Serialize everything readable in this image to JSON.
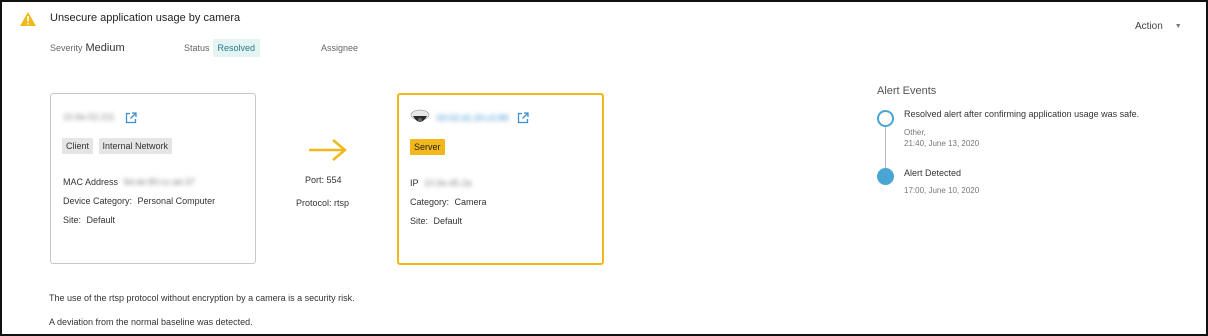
{
  "alert": {
    "title": "Unsecure application usage by camera",
    "action_label": "Action",
    "severity_label": "Severity",
    "severity_value": "Medium",
    "status_label": "Status",
    "status_value": "Resolved",
    "assignee_label": "Assignee"
  },
  "source": {
    "ip": "10.6e.52.211",
    "tags": [
      "Client",
      "Internal Network"
    ],
    "mac_label": "MAC Address",
    "mac_value": "9d:de:80:cc:ab:37",
    "category_label": "Device Category:",
    "category_value": "Personal Computer",
    "site_label": "Site:",
    "site_value": "Default"
  },
  "connection": {
    "port": "Port: 554",
    "protocol": "Protocol: rtsp"
  },
  "destination": {
    "mac": "00:02:d1:20:c0:89",
    "tag": "Server",
    "ip_label": "IP",
    "ip_value": "10.6e.d5.2a",
    "category_label": "Category:",
    "category_value": "Camera",
    "site_label": "Site:",
    "site_value": "Default"
  },
  "events": {
    "title": "Alert Events",
    "items": [
      {
        "text": "Resolved alert after confirming application usage was safe.",
        "sub1": "Other,",
        "sub2": "21:40, June 13, 2020"
      },
      {
        "text": "Alert Detected",
        "sub1": "17:00, June 10, 2020"
      }
    ]
  },
  "description": {
    "line1": "The use of the rtsp protocol without encryption by a camera is a security risk.",
    "line2": "A deviation from the normal baseline was detected."
  },
  "colors": {
    "accent": "#f2b71a",
    "timeline": "#49a5d4",
    "resolved_bg": "#e3f4f2"
  },
  "icons": [
    "warning-icon",
    "external-link-icon",
    "arrow-right-icon",
    "camera-icon",
    "caret-down-icon"
  ]
}
